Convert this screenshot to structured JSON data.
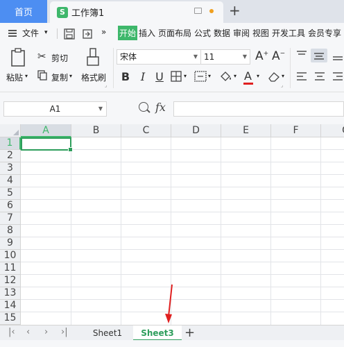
{
  "titlebar": {
    "home_tab": "首页",
    "doc_icon_letter": "S",
    "doc_title": "工作簿1"
  },
  "menubar": {
    "file_label": "文件",
    "more": "»",
    "tabs": [
      "开始",
      "插入",
      "页面布局",
      "公式",
      "数据",
      "审阅",
      "视图",
      "开发工具",
      "会员专享"
    ],
    "active_tab": "开始"
  },
  "ribbon": {
    "paste": "粘贴",
    "cut": "剪切",
    "copy": "复制",
    "format_painter": "格式刷",
    "font_name": "宋体",
    "font_size": "11",
    "bold": "B",
    "italic": "I",
    "underline": "U",
    "grow_font": "A+",
    "shrink_font": "A-",
    "font_color_glyph": "A"
  },
  "formulabar": {
    "name_box": "A1",
    "fx": "fx",
    "formula": ""
  },
  "grid": {
    "columns": [
      "A",
      "B",
      "C",
      "D",
      "E",
      "F",
      "G"
    ],
    "rows": [
      "1",
      "2",
      "3",
      "4",
      "5",
      "6",
      "7",
      "8",
      "9",
      "10",
      "11",
      "12",
      "13",
      "14",
      "15"
    ],
    "selected_column": "A",
    "selected_row": "1"
  },
  "sheets": {
    "tabs": [
      "Sheet1",
      "Sheet3"
    ],
    "active": "Sheet3",
    "add": "+"
  },
  "colors": {
    "accent_green": "#3eb76b",
    "home_tab_blue": "#4d8ef2",
    "arrow_red": "#e02020"
  }
}
